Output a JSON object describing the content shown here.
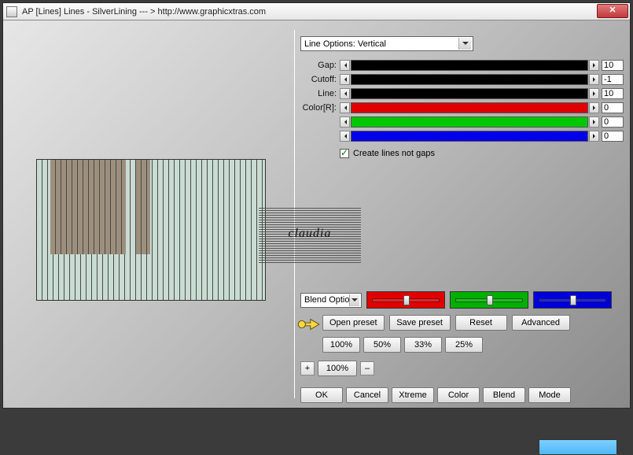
{
  "title": "AP [Lines]  Lines - SilverLining    --- >  http://www.graphicxtras.com",
  "lineOptions": {
    "selected": "Line Options: Vertical"
  },
  "sliders": [
    {
      "label": "Gap:",
      "value": "10",
      "bar": "black"
    },
    {
      "label": "Cutoff:",
      "value": "-1",
      "bar": "black"
    },
    {
      "label": "Line:",
      "value": "10",
      "bar": "black"
    },
    {
      "label": "Color[R]:",
      "value": "0",
      "bar": "red"
    },
    {
      "label": "",
      "value": "0",
      "bar": "green"
    },
    {
      "label": "",
      "value": "0",
      "bar": "blue"
    }
  ],
  "checkbox": {
    "label": "Create lines not gaps",
    "checked": true
  },
  "blendOptions": {
    "selected": "Blend Options"
  },
  "colorMix": {
    "r": 50,
    "g": 50,
    "b": 50
  },
  "buttons": {
    "openPreset": "Open preset",
    "savePreset": "Save preset",
    "reset": "Reset",
    "advanced": "Advanced"
  },
  "percents": [
    "100%",
    "50%",
    "33%",
    "25%"
  ],
  "zoom": {
    "plus": "+",
    "value": "100%",
    "minus": "–"
  },
  "mainButtons": [
    "OK",
    "Cancel",
    "Xtreme",
    "Color",
    "Blend",
    "Mode"
  ],
  "watermark": "claudia",
  "closeGlyph": "✕"
}
